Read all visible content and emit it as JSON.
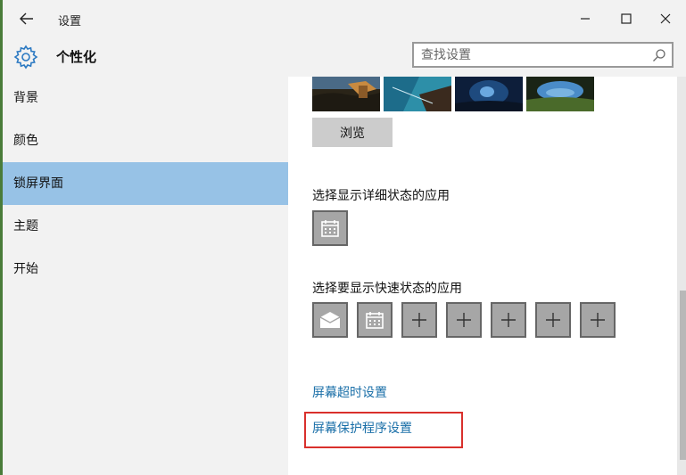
{
  "window": {
    "title": "设置",
    "back_icon": "arrow-left-icon",
    "minimize_icon": "minimize-icon",
    "maximize_icon": "maximize-icon",
    "close_icon": "close-icon"
  },
  "header": {
    "icon": "gear-icon",
    "title": "个性化",
    "search_placeholder": "查找设置",
    "search_icon": "search-icon"
  },
  "sidebar": {
    "items": [
      {
        "label": "背景",
        "active": false
      },
      {
        "label": "颜色",
        "active": false
      },
      {
        "label": "锁屏界面",
        "active": true
      },
      {
        "label": "主题",
        "active": false
      },
      {
        "label": "开始",
        "active": false
      }
    ]
  },
  "content": {
    "browse_label": "浏览",
    "detailed_status_label": "选择显示详细状态的应用",
    "detailed_status_apps": [
      "calendar-icon"
    ],
    "quick_status_label": "选择要显示快速状态的应用",
    "quick_status_apps": [
      "mail-icon",
      "calendar-icon",
      "plus-icon",
      "plus-icon",
      "plus-icon",
      "plus-icon",
      "plus-icon"
    ],
    "screen_timeout_link": "屏幕超时设置",
    "screensaver_link": "屏幕保护程序设置"
  },
  "colors": {
    "accent_active": "#97c2e6",
    "link": "#1a6fa8",
    "highlight_border": "#d9302c"
  }
}
